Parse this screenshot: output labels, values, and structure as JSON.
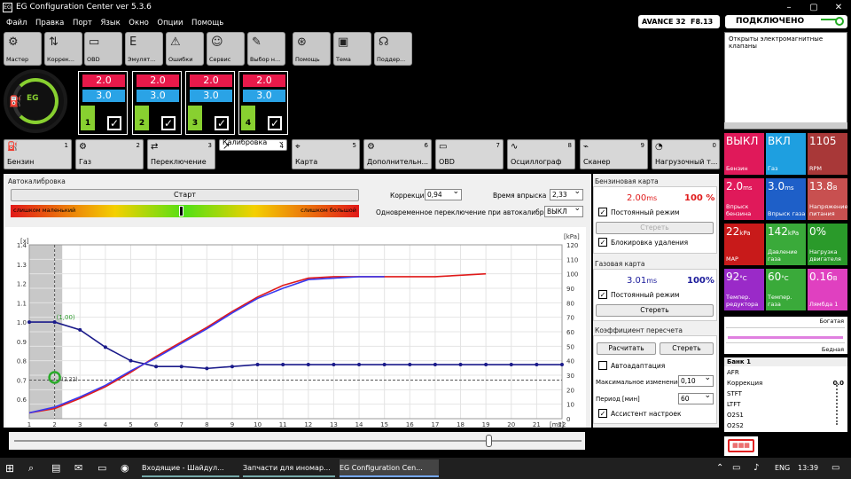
{
  "app": {
    "title": "EG Configuration Center ver 5.3.6"
  },
  "menu": [
    "Файл",
    "Правка",
    "Порт",
    "Язык",
    "Окно",
    "Опции",
    "Помощь"
  ],
  "toolbar": [
    {
      "label": "Мастер",
      "icon": "wizard-icon"
    },
    {
      "label": "Коррек...",
      "icon": "correction-icon"
    },
    {
      "label": "OBD",
      "icon": "obd-icon"
    },
    {
      "label": "Эмулят...",
      "icon": "emulator-icon"
    },
    {
      "label": "Ошибки",
      "icon": "warning-icon"
    },
    {
      "label": "Сервис",
      "icon": "service-icon"
    },
    {
      "label": "Выбор н...",
      "icon": "select-icon"
    },
    {
      "label": "Помощь",
      "icon": "help-icon"
    },
    {
      "label": "Тема",
      "icon": "theme-icon"
    },
    {
      "label": "Поддер...",
      "icon": "support-icon"
    }
  ],
  "status": {
    "device": "AVANCE 32",
    "version": "F8.13",
    "connection": "ПОДКЛЮЧЕНО"
  },
  "messages": {
    "text": "Открыты электромагнитные клапаны"
  },
  "injectors": [
    {
      "num": "1",
      "top": "2.0",
      "bottom": "3.0",
      "checked": "✓"
    },
    {
      "num": "2",
      "top": "2.0",
      "bottom": "3.0",
      "checked": "✓"
    },
    {
      "num": "3",
      "top": "2.0",
      "bottom": "3.0",
      "checked": "✓"
    },
    {
      "num": "4",
      "top": "2.0",
      "bottom": "3.0",
      "checked": "✓"
    }
  ],
  "tabs": [
    {
      "label": "Бензин",
      "num": "1"
    },
    {
      "label": "Газ",
      "num": "2"
    },
    {
      "label": "Переключение",
      "num": "3"
    },
    {
      "label": "Калибровка",
      "num": "4"
    },
    {
      "label": "Карта",
      "num": "5"
    },
    {
      "label": "Дополнительн...",
      "num": "6"
    },
    {
      "label": "OBD",
      "num": "7"
    },
    {
      "label": "Осциллограф",
      "num": "8"
    },
    {
      "label": "Сканер",
      "num": "9"
    },
    {
      "label": "Нагрузочный т...",
      "num": "0"
    }
  ],
  "autocal": {
    "title": "Автокалибровка",
    "start": "Старт",
    "bar_left": "слишком маленький",
    "bar_right": "слишком большой",
    "correction_label": "Коррекция",
    "correction_value": "0,94",
    "inj_time_label": "Время впрыска",
    "inj_time_value": "2,33",
    "simul_label": "Одновременное переключение при автокалибровке",
    "simul_value": "ВЫКЛ"
  },
  "petrol_map": {
    "title": "Бензиновая карта",
    "ms": "2.00",
    "ms_unit": "ms",
    "percent": "100 %",
    "constant_mode": "Постоянный режим",
    "erase": "Стереть",
    "lock_delete": "Блокировка удаления"
  },
  "gas_map": {
    "title": "Газовая карта",
    "ms": "3.01",
    "ms_unit": "ms",
    "percent": "100%",
    "constant_mode": "Постоянный режим",
    "erase": "Стереть"
  },
  "recalc": {
    "title": "Коэффициент пересчета",
    "calc": "Расчитать",
    "erase": "Стереть",
    "autoadapt": "Автоадаптация",
    "max_change_label": "Максимальное изменение",
    "max_change_value": "0,10",
    "period_label": "Период [мин]",
    "period_value": "60",
    "assistant": "Ассистент настроек"
  },
  "tiles": [
    {
      "value": "ВЫКЛ",
      "unit": "",
      "label": "Бензин",
      "color": "#e0195a"
    },
    {
      "value": "ВКЛ",
      "unit": "",
      "label": "Газ",
      "color": "#1e9fe0"
    },
    {
      "value": "1105",
      "unit": "",
      "label": "RPM",
      "color": "#a83838"
    },
    {
      "value": "2.0",
      "unit": "ms",
      "label": "Впрыск бензина",
      "color": "#e0195a"
    },
    {
      "value": "3.0",
      "unit": "ms",
      "label": "Впрыск газа",
      "color": "#1e5fc8"
    },
    {
      "value": "13.8",
      "unit": "В",
      "label": "Напряжение питания",
      "color": "#c85050"
    },
    {
      "value": "22",
      "unit": "kPa",
      "label": "MAP",
      "color": "#c81a1a"
    },
    {
      "value": "142",
      "unit": "kPa",
      "label": "Давление газа",
      "color": "#3aaa3a"
    },
    {
      "value": "0%",
      "unit": "",
      "label": "Нагрузка двигателя",
      "color": "#2a9a2a"
    },
    {
      "value": "92",
      "unit": "°C",
      "label": "Темпер. редуктора",
      "color": "#9a2ac8"
    },
    {
      "value": "60",
      "unit": "°C",
      "label": "Темпер. газа",
      "color": "#3aaa3a"
    },
    {
      "value": "0.16",
      "unit": "В",
      "label": "Лямбда 1",
      "color": "#e040c0"
    }
  ],
  "lambda": {
    "rich": "Богатая",
    "lean": "Бедная"
  },
  "bank": {
    "title": "Банк 1",
    "rows": [
      {
        "label": "AFR",
        "value": ""
      },
      {
        "label": "Коррекция",
        "value": "0.0"
      },
      {
        "label": "STFT",
        "value": ""
      },
      {
        "label": "LTFT",
        "value": ""
      },
      {
        "label": "O2S1",
        "value": ""
      },
      {
        "label": "O2S2",
        "value": ""
      }
    ]
  },
  "taskbar": {
    "items": [
      "Входящие - Шайдул...",
      "Запчасти для иномар...",
      "EG Configuration Cen..."
    ],
    "lang": "ENG",
    "time": "13:39"
  },
  "chart_data": {
    "type": "line",
    "x_unit": "[ms]",
    "y_left_unit": "[x]",
    "y_right_unit": "[kPa]",
    "xlim": [
      1,
      22
    ],
    "ylim_left": [
      0.5,
      1.4
    ],
    "ylim_right": [
      0,
      120
    ],
    "x_ticks": [
      1,
      2,
      3,
      4,
      5,
      6,
      7,
      8,
      9,
      10,
      11,
      12,
      13,
      14,
      15,
      16,
      17,
      18,
      19,
      20,
      21,
      22
    ],
    "y_left_ticks": [
      0.6,
      0.7,
      0.8,
      0.9,
      1.0,
      1.1,
      1.2,
      1.3,
      1.4
    ],
    "y_right_ticks": [
      0,
      10,
      20,
      30,
      40,
      50,
      60,
      70,
      80,
      90,
      100,
      110,
      120
    ],
    "annotations": [
      "(1,00)",
      "(2,22)"
    ],
    "series": [
      {
        "color": "#1a1a8a",
        "axis": "left",
        "x": [
          1,
          2,
          3,
          4,
          5,
          6,
          7,
          8,
          9,
          10,
          11,
          12,
          13,
          14,
          15,
          16,
          17,
          18,
          19,
          20,
          21,
          22
        ],
        "y": [
          1.0,
          1.0,
          0.96,
          0.87,
          0.8,
          0.77,
          0.77,
          0.76,
          0.77,
          0.78,
          0.78,
          0.78,
          0.78,
          0.78,
          0.78,
          0.78,
          0.78,
          0.78,
          0.78,
          0.78,
          0.78,
          0.78
        ]
      },
      {
        "color": "#e01a1a",
        "axis": "right",
        "x": [
          1,
          2,
          3,
          4,
          5,
          6,
          7,
          8,
          9,
          10,
          11,
          12,
          13,
          14,
          15,
          16,
          17,
          18,
          19
        ],
        "y": [
          4,
          7,
          14,
          22,
          32,
          43,
          53,
          63,
          74,
          84,
          92,
          97,
          98,
          98,
          98,
          98,
          98,
          99,
          100
        ]
      },
      {
        "color": "#3a3aee",
        "axis": "right",
        "x": [
          1,
          2,
          3,
          4,
          5,
          6,
          7,
          8,
          9,
          10,
          11,
          12,
          13,
          14,
          15
        ],
        "y": [
          4,
          8,
          15,
          23,
          33,
          42,
          52,
          62,
          73,
          83,
          90,
          96,
          97,
          98,
          98
        ]
      }
    ]
  }
}
